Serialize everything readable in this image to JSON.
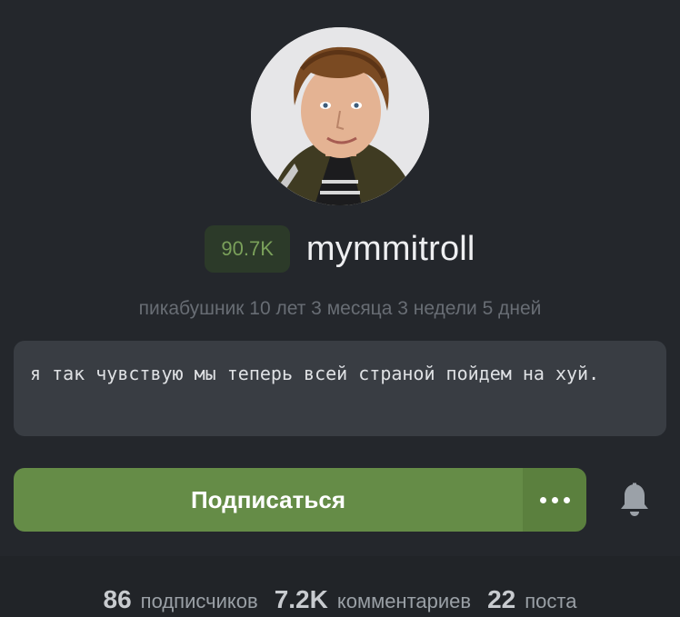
{
  "profile": {
    "rating": "90.7K",
    "username": "mymmitroll",
    "tenure": "пикабушник 10 лет 3 месяца 3 недели 5 дней",
    "bio": "я так чувствую мы теперь всей страной пойдем на хуй.",
    "avatar_icon": "user-avatar-photo"
  },
  "actions": {
    "subscribe_label": "Подписаться",
    "more_icon": "more-dots-icon",
    "bell_icon": "bell-icon"
  },
  "stats": [
    {
      "value": "86",
      "label": "подписчиков"
    },
    {
      "value": "7.2K",
      "label": "комментариев"
    },
    {
      "value": "22",
      "label": "поста"
    }
  ],
  "colors": {
    "background": "#24272c",
    "accent_green": "#658c47",
    "rating_text": "#7aa05a",
    "bio_background": "#393d43"
  }
}
